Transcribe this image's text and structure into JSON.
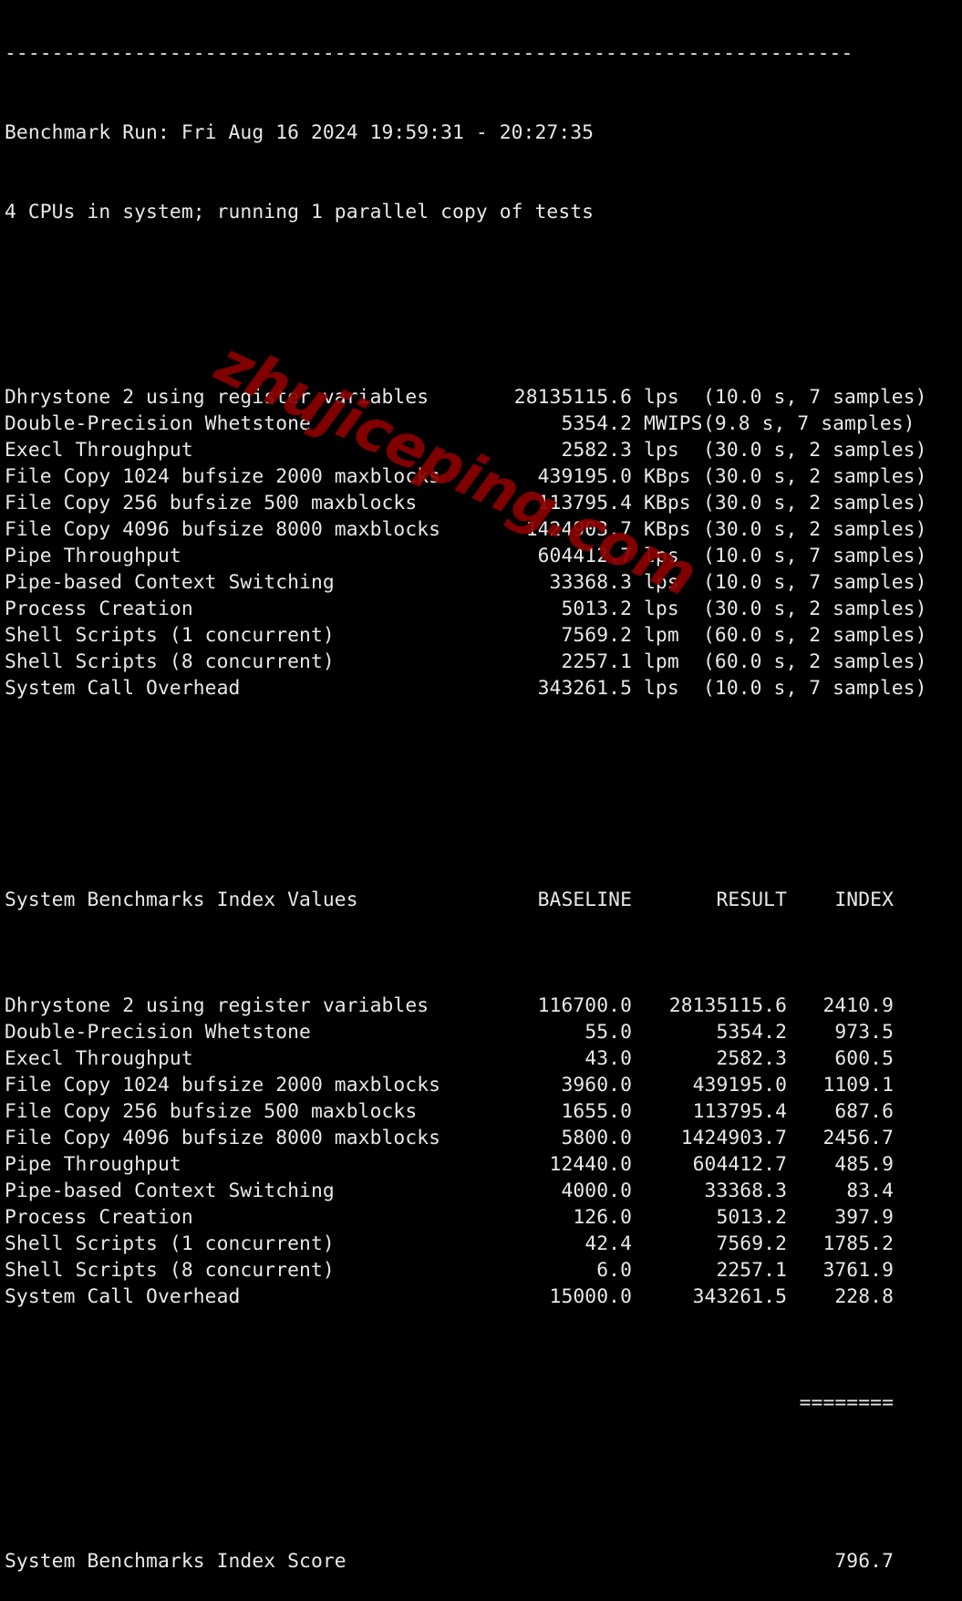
{
  "terminal": {
    "separator": "------------------------------------------------------------------------",
    "benchmark_run": "Benchmark Run: Fri Aug 16 2024 19:59:31 - 20:27:35",
    "cpu_info": "4 CPUs in system; running 1 parallel copy of tests",
    "tests": [
      {
        "name": "Dhrystone 2 using register variables",
        "value": "28135115.6",
        "unit": "lps",
        "timing": "(10.0 s, 7 samples)"
      },
      {
        "name": "Double-Precision Whetstone",
        "value": "5354.2",
        "unit": "MWIPS",
        "timing": "(9.8 s, 7 samples)"
      },
      {
        "name": "Execl Throughput",
        "value": "2582.3",
        "unit": "lps",
        "timing": "(30.0 s, 2 samples)"
      },
      {
        "name": "File Copy 1024 bufsize 2000 maxblocks",
        "value": "439195.0",
        "unit": "KBps",
        "timing": "(30.0 s, 2 samples)"
      },
      {
        "name": "File Copy 256 bufsize 500 maxblocks",
        "value": "113795.4",
        "unit": "KBps",
        "timing": "(30.0 s, 2 samples)"
      },
      {
        "name": "File Copy 4096 bufsize 8000 maxblocks",
        "value": "1424903.7",
        "unit": "KBps",
        "timing": "(30.0 s, 2 samples)"
      },
      {
        "name": "Pipe Throughput",
        "value": "604412.7",
        "unit": "lps",
        "timing": "(10.0 s, 7 samples)"
      },
      {
        "name": "Pipe-based Context Switching",
        "value": "33368.3",
        "unit": "lps",
        "timing": "(10.0 s, 7 samples)"
      },
      {
        "name": "Process Creation",
        "value": "5013.2",
        "unit": "lps",
        "timing": "(30.0 s, 2 samples)"
      },
      {
        "name": "Shell Scripts (1 concurrent)",
        "value": "7569.2",
        "unit": "lpm",
        "timing": "(60.0 s, 2 samples)"
      },
      {
        "name": "Shell Scripts (8 concurrent)",
        "value": "2257.1",
        "unit": "lpm",
        "timing": "(60.0 s, 2 samples)"
      },
      {
        "name": "System Call Overhead",
        "value": "343261.5",
        "unit": "lps",
        "timing": "(10.0 s, 7 samples)"
      }
    ],
    "index_table": {
      "title": "System Benchmarks Index Values",
      "headers": {
        "baseline": "BASELINE",
        "result": "RESULT",
        "index": "INDEX"
      },
      "rows": [
        {
          "name": "Dhrystone 2 using register variables",
          "baseline": "116700.0",
          "result": "28135115.6",
          "index": "2410.9"
        },
        {
          "name": "Double-Precision Whetstone",
          "baseline": "55.0",
          "result": "5354.2",
          "index": "973.5"
        },
        {
          "name": "Execl Throughput",
          "baseline": "43.0",
          "result": "2582.3",
          "index": "600.5"
        },
        {
          "name": "File Copy 1024 bufsize 2000 maxblocks",
          "baseline": "3960.0",
          "result": "439195.0",
          "index": "1109.1"
        },
        {
          "name": "File Copy 256 bufsize 500 maxblocks",
          "baseline": "1655.0",
          "result": "113795.4",
          "index": "687.6"
        },
        {
          "name": "File Copy 4096 bufsize 8000 maxblocks",
          "baseline": "5800.0",
          "result": "1424903.7",
          "index": "2456.7"
        },
        {
          "name": "Pipe Throughput",
          "baseline": "12440.0",
          "result": "604412.7",
          "index": "485.9"
        },
        {
          "name": "Pipe-based Context Switching",
          "baseline": "4000.0",
          "result": "33368.3",
          "index": "83.4"
        },
        {
          "name": "Process Creation",
          "baseline": "126.0",
          "result": "5013.2",
          "index": "397.9"
        },
        {
          "name": "Shell Scripts (1 concurrent)",
          "baseline": "42.4",
          "result": "7569.2",
          "index": "1785.2"
        },
        {
          "name": "Shell Scripts (8 concurrent)",
          "baseline": "6.0",
          "result": "2257.1",
          "index": "3761.9"
        },
        {
          "name": "System Call Overhead",
          "baseline": "15000.0",
          "result": "343261.5",
          "index": "228.8"
        }
      ],
      "rule": "========",
      "score_label": "System Benchmarks Index Score",
      "score": "796.7"
    }
  },
  "watermark": "zhujiceping.com",
  "colors": {
    "background": "#000000",
    "text": "#e8e8e8",
    "watermark": "#8b0000"
  }
}
